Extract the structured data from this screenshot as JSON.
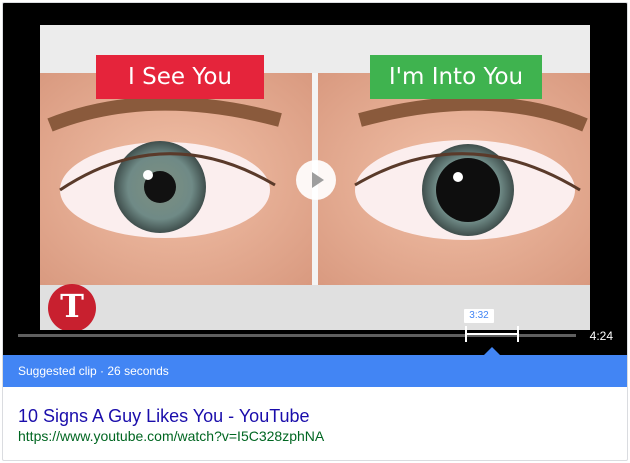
{
  "video": {
    "left_label": "I See You",
    "right_label": "I'm Into You",
    "logo_letter": "T",
    "clip_time": "3:32",
    "duration": "4:24",
    "colors": {
      "left_label_bg": "#e5243b",
      "right_label_bg": "#3fb34f",
      "logo": "#c8202f",
      "accent": "#4285f4"
    }
  },
  "suggested": {
    "label": "Suggested clip · 26 seconds"
  },
  "result": {
    "title": "10 Signs A Guy Likes You - YouTube",
    "url": "https://www.youtube.com/watch?v=I5C328zphNA"
  }
}
